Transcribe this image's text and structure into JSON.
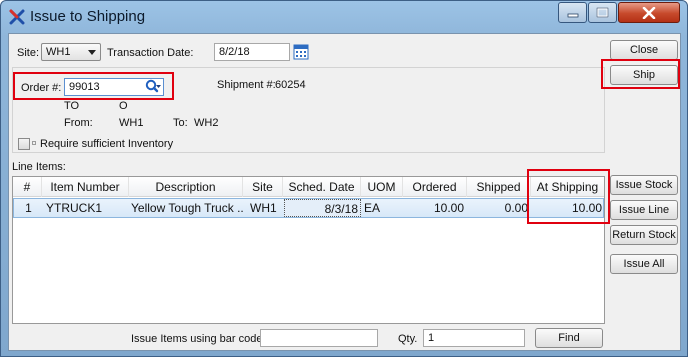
{
  "window": {
    "title": "Issue to Shipping",
    "controls": {
      "minimize": "minimize",
      "maximize": "maximize",
      "close": "close"
    }
  },
  "header": {
    "site_label": "Site:",
    "site_value": "WH1",
    "transaction_date_label": "Transaction Date:",
    "transaction_date_value": "8/2/18",
    "order_label": "Order #:",
    "order_value": "99013",
    "shipment_label": "Shipment #:",
    "shipment_value": "60254",
    "order_type": "TO",
    "order_status": "O",
    "from_label": "From:",
    "from_value": "WH1",
    "to_label": "To:",
    "to_value": "WH2",
    "require_inventory_label": "Require sufficient Inventory",
    "require_inventory_checked": false
  },
  "line_items": {
    "label": "Line Items:",
    "columns": [
      "#",
      "Item Number",
      "Description",
      "Site",
      "Sched. Date",
      "UOM",
      "Ordered",
      "Shipped",
      "At Shipping"
    ],
    "rows": [
      {
        "num": "1",
        "item_number": "YTRUCK1",
        "description": "Yellow Tough Truck ...",
        "site": "WH1",
        "sched_date": "8/3/18",
        "uom": "EA",
        "ordered": "10.00",
        "shipped": "0.00",
        "at_shipping": "10.00"
      }
    ]
  },
  "buttons": {
    "close": "Close",
    "ship": "Ship",
    "issue_stock": "Issue Stock",
    "issue_line": "Issue Line",
    "return_stock": "Return Stock",
    "issue_all": "Issue All",
    "find": "Find"
  },
  "barcode": {
    "label": "Issue Items using bar code:",
    "value": "",
    "qty_label": "Qty.",
    "qty_value": "1"
  },
  "colors": {
    "highlight": "#e0000f",
    "selected_row": "#d7e8f8",
    "title_bar": "#8fb6da"
  }
}
